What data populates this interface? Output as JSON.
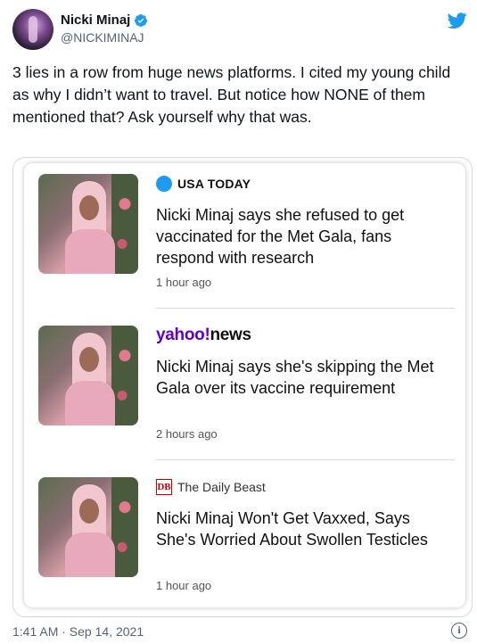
{
  "tweet": {
    "name": "Nicki Minaj",
    "handle": "@NICKIMINAJ",
    "text": "3 lies in a row from huge news platforms. I cited my young child as why I didn’t want to travel. But notice how NONE of them mentioned that? Ask yourself why that was.",
    "timestamp": "1:41 AM · Sep 14, 2021",
    "info_glyph": "i",
    "brand_color": "#1d9bf0"
  },
  "articles": [
    {
      "source": "USA TODAY",
      "headline": "Nicki Minaj says she refused to get vaccinated for the Met Gala, fans respond with research",
      "time": "1 hour ago"
    },
    {
      "source_main": "yahoo!",
      "source_sub": "news",
      "headline": "Nicki Minaj says she's skipping the Met Gala over its vaccine requirement",
      "time": "2 hours ago"
    },
    {
      "source_logo": "DB",
      "source": "The Daily Beast",
      "headline": "Nicki Minaj Won't Get Vaxxed, Says She's Worried About Swollen Testicles",
      "time": "1 hour ago"
    }
  ]
}
